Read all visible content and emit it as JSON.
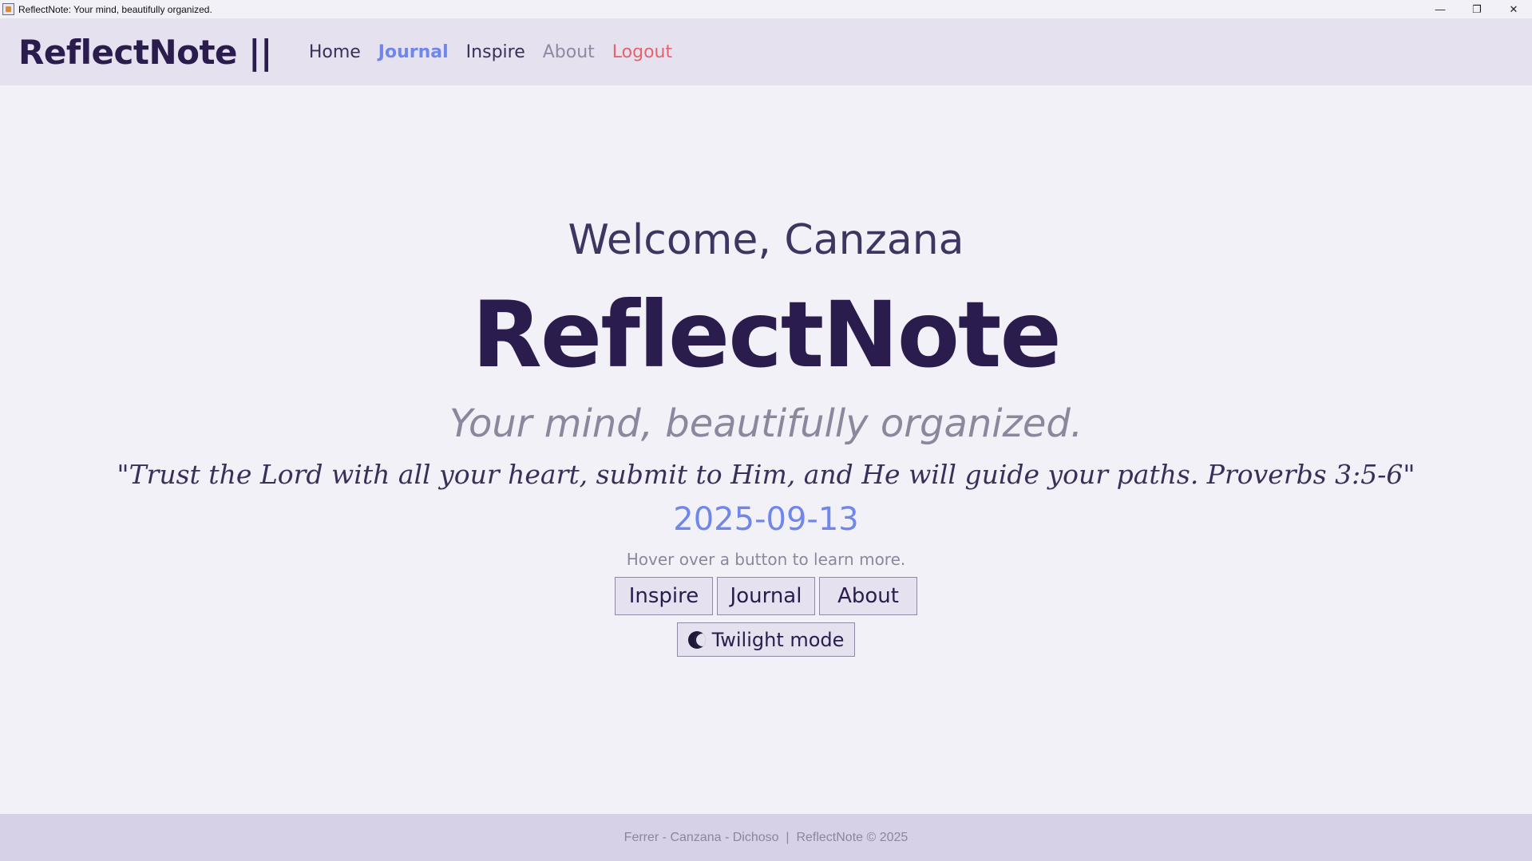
{
  "window": {
    "title": "ReflectNote: Your mind, beautifully organized.",
    "controls": {
      "minimize": "—",
      "restore": "❐",
      "close": "✕"
    }
  },
  "navbar": {
    "brand": "ReflectNote ||",
    "links": [
      {
        "label": "Home",
        "state": "normal"
      },
      {
        "label": "Journal",
        "state": "active"
      },
      {
        "label": "Inspire",
        "state": "normal"
      },
      {
        "label": "About",
        "state": "muted"
      },
      {
        "label": "Logout",
        "state": "danger"
      }
    ]
  },
  "main": {
    "welcome": "Welcome, Canzana",
    "title": "ReflectNote",
    "tagline": "Your mind, beautifully organized.",
    "quote": "\"Trust the Lord with all your heart, submit to Him, and He will guide your paths. Proverbs 3:5-6\"",
    "date": "2025-09-13",
    "hint": "Hover over a button to learn more.",
    "buttons": {
      "inspire": "Inspire",
      "journal": "Journal",
      "about": "About"
    },
    "twilight": {
      "label": "Twilight mode",
      "icon": "moon-icon"
    }
  },
  "footer": {
    "text": "Ferrer - Canzana - Dichoso  |  ReflectNote © 2025"
  },
  "colors": {
    "background": "#f3f1f8",
    "navbar": "#e5e1ef",
    "footer": "#d6d1e6",
    "brand": "#2a1d4e",
    "accent": "#6f86ea",
    "danger": "#e4636c",
    "muted": "#8b879c"
  }
}
